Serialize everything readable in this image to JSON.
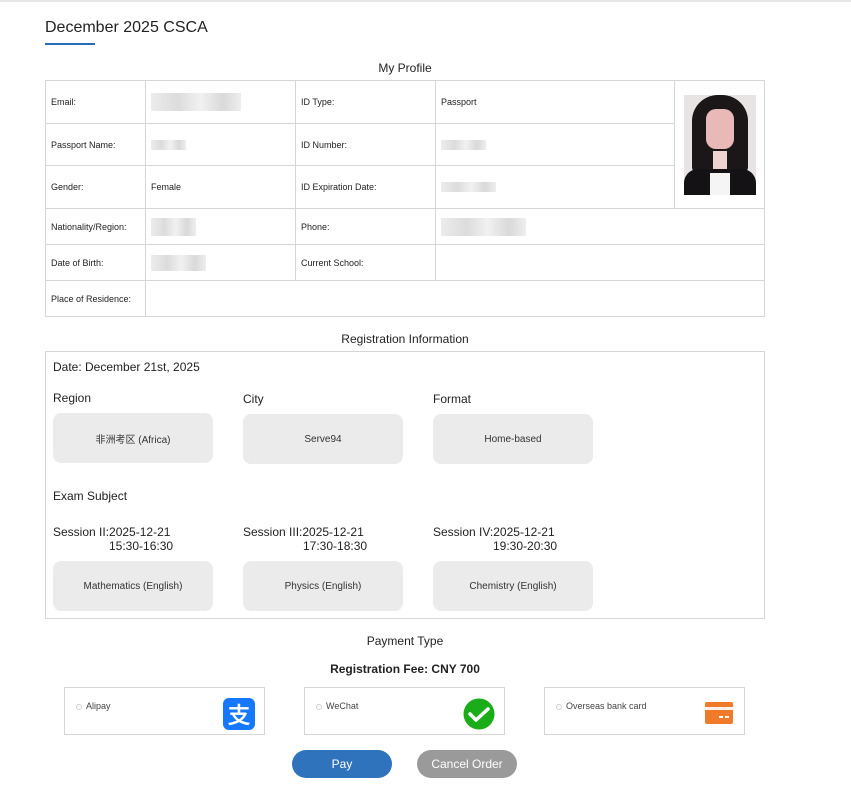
{
  "page": {
    "title": "December 2025 CSCA"
  },
  "profile": {
    "section_title": "My Profile",
    "email_label": "Email:",
    "id_type_label": "ID Type:",
    "id_type_value": "Passport",
    "passport_name_label": "Passport Name:",
    "id_number_label": "ID Number:",
    "gender_label": "Gender:",
    "gender_value": "Female",
    "id_expiration_label": "ID Expiration Date:",
    "nationality_label": "Nationality/Region:",
    "phone_label": "Phone:",
    "dob_label": "Date of Birth:",
    "school_label": "Current School:",
    "residence_label": "Place of Residence:"
  },
  "registration": {
    "section_title": "Registration Information",
    "date": "Date: December 21st, 2025",
    "region_label": "Region",
    "region_value": "非洲考区 (Africa)",
    "city_label": "City",
    "city_value": "Serve94",
    "format_label": "Format",
    "format_value": "Home-based",
    "subject_label": "Exam Subject",
    "sessions": [
      {
        "title": "Session II:2025-12-21",
        "time": "15:30-16:30",
        "subject": "Mathematics (English)"
      },
      {
        "title": "Session III:2025-12-21",
        "time": "17:30-18:30",
        "subject": "Physics (English)"
      },
      {
        "title": "Session IV:2025-12-21",
        "time": "19:30-20:30",
        "subject": "Chemistry (English)"
      }
    ]
  },
  "payment": {
    "section_title": "Payment Type",
    "fee": "Registration Fee: CNY 700",
    "options": [
      {
        "label": "Alipay",
        "icon": "alipay-icon",
        "color": "#1677ff"
      },
      {
        "label": "WeChat",
        "icon": "wechat-pay-icon",
        "color": "#1aad19"
      },
      {
        "label": "Overseas bank card",
        "icon": "bank-card-icon",
        "color": "#f07a2a"
      }
    ],
    "pay_label": "Pay",
    "cancel_label": "Cancel Order"
  },
  "colors": {
    "accent": "#2f73bd",
    "cancel": "#9a9a9a",
    "pill": "#ebebeb"
  }
}
